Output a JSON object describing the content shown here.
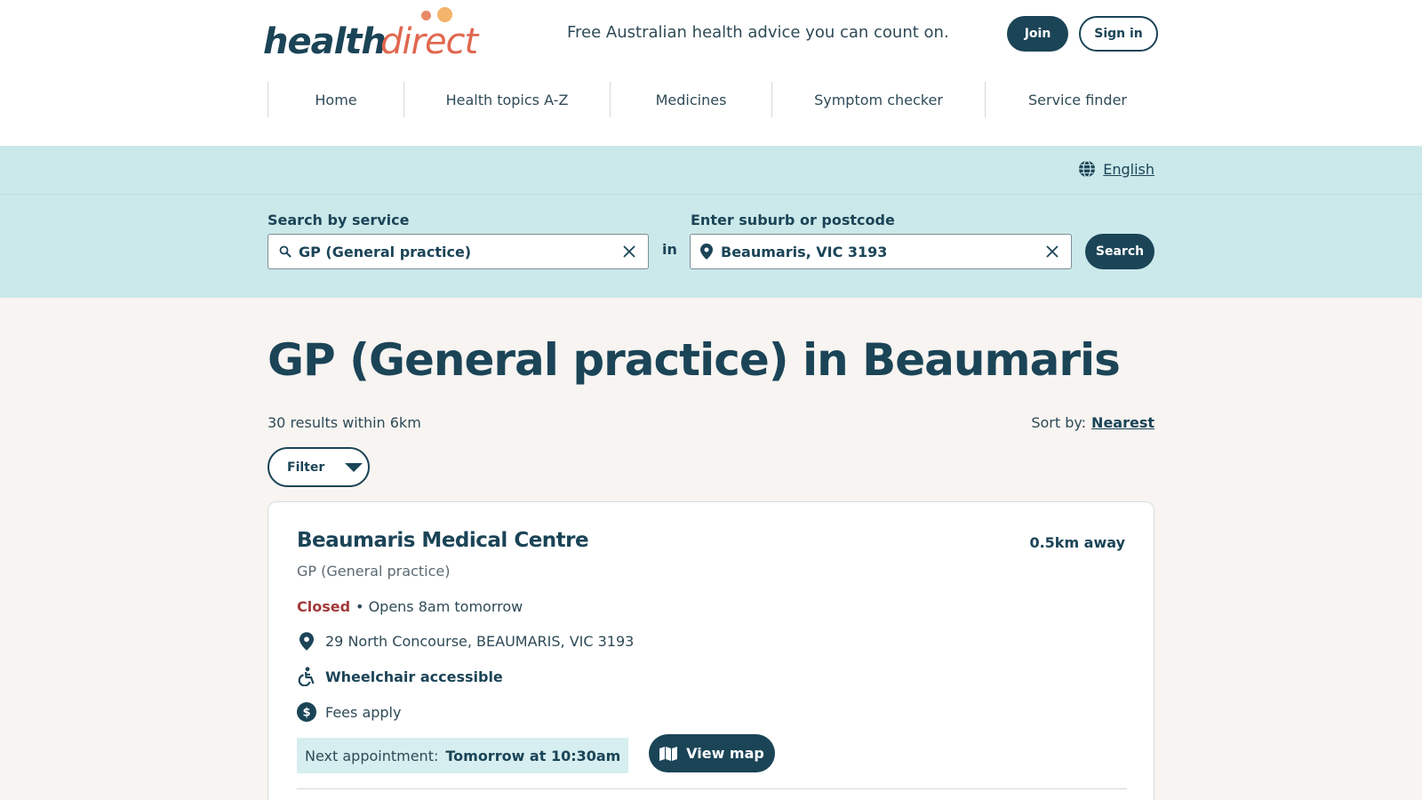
{
  "header": {
    "logo_health": "health",
    "logo_direct": "direct",
    "tagline": "Free Australian health advice you can count on.",
    "join_label": "Join",
    "signin_label": "Sign in"
  },
  "nav": [
    {
      "label": "Home"
    },
    {
      "label": "Health topics A-Z"
    },
    {
      "label": "Medicines"
    },
    {
      "label": "Symptom checker"
    },
    {
      "label": "Service finder"
    }
  ],
  "language": {
    "label": "English",
    "icon": "globe-icon"
  },
  "search": {
    "service_label": "Search by service",
    "service_value": "GP (General practice)",
    "in_label": "in",
    "location_label": "Enter suburb or postcode",
    "location_value": "Beaumaris, VIC 3193",
    "search_button": "Search"
  },
  "results": {
    "title": "GP (General practice) in Beaumaris",
    "count_text": "30 results within 6km",
    "sort_label": "Sort by:",
    "sort_value": "Nearest",
    "filter_label": "Filter"
  },
  "card": {
    "name": "Beaumaris Medical Centre",
    "distance": "0.5km away",
    "type": "GP (General practice)",
    "status": "Closed",
    "opens": "• Opens 8am tomorrow",
    "address": "29 North Concourse, BEAUMARIS, VIC 3193",
    "accessibility": "Wheelchair accessible",
    "fees": "Fees apply",
    "appointment_label": "Next appointment:",
    "appointment_value": "Tomorrow at 10:30am",
    "map_button": "View map"
  },
  "colors": {
    "brand": "#1b4457",
    "accent": "#e0684f",
    "search_bg": "#cbe9ea",
    "page_bg": "#f7f4f1",
    "closed": "#a33a3a"
  }
}
